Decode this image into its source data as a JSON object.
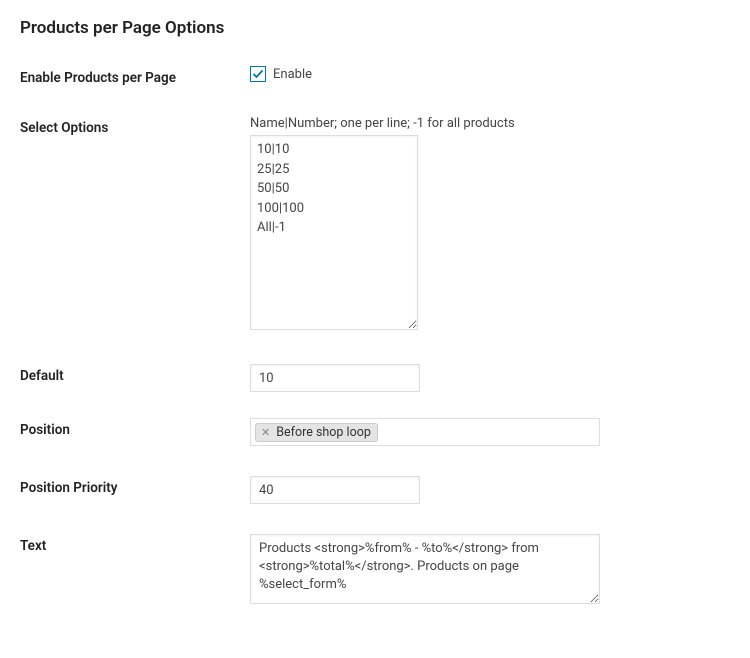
{
  "section_title": "Products per Page Options",
  "fields": {
    "enable": {
      "label": "Enable Products per Page",
      "checkbox_label": "Enable",
      "checked": true
    },
    "select_options": {
      "label": "Select Options",
      "description": "Name|Number; one per line; -1 for all products",
      "value": "10|10\n25|25\n50|50\n100|100\nAll|-1"
    },
    "default": {
      "label": "Default",
      "value": "10"
    },
    "position": {
      "label": "Position",
      "tag": "Before shop loop"
    },
    "position_priority": {
      "label": "Position Priority",
      "value": "40"
    },
    "text": {
      "label": "Text",
      "value": "Products <strong>%from% - %to%</strong> from <strong>%total%</strong>. Products on page %select_form%"
    }
  }
}
